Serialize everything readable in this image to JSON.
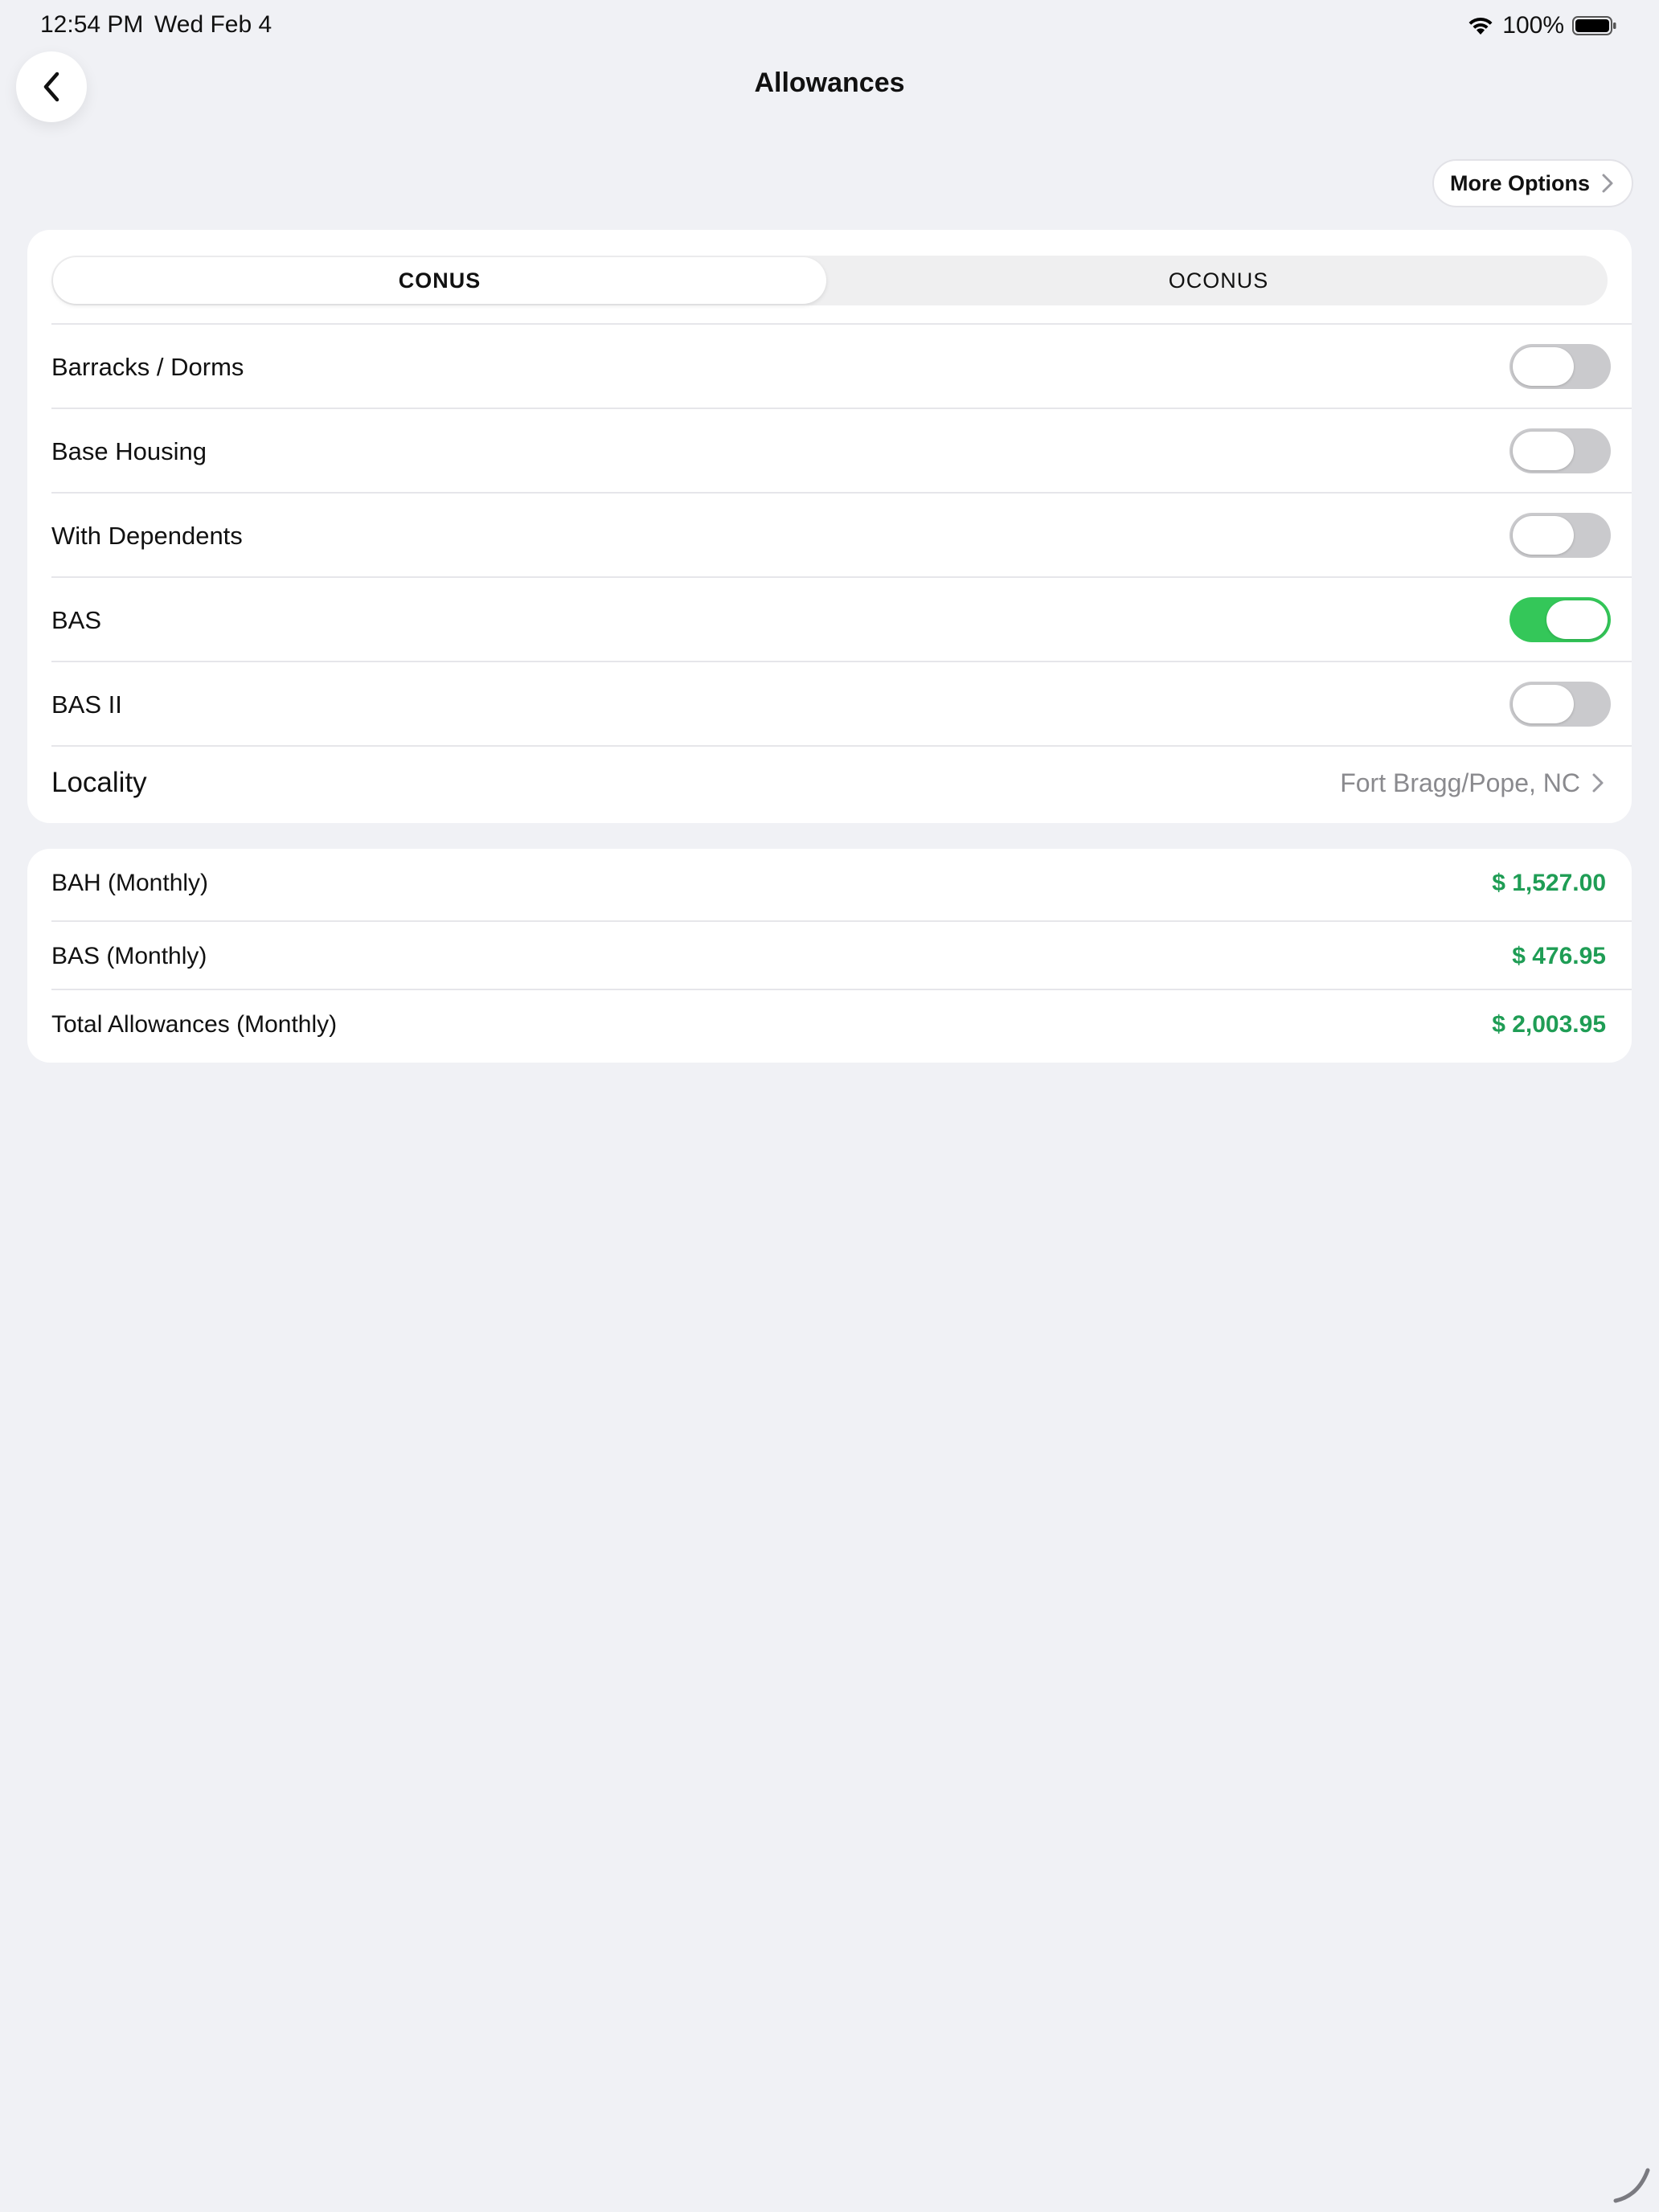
{
  "status_bar": {
    "time": "12:54 PM",
    "date": "Wed Feb 4",
    "battery_percent": "100%",
    "icons": [
      "wifi-icon",
      "battery-icon"
    ]
  },
  "nav": {
    "title": "Allowances",
    "back_icon": "chevron-left-icon"
  },
  "more_options": {
    "label": "More Options"
  },
  "segmented_control": {
    "options": [
      {
        "label": "CONUS",
        "selected": true
      },
      {
        "label": "OCONUS",
        "selected": false
      }
    ]
  },
  "toggles": [
    {
      "label": "Barracks / Dorms",
      "on": false
    },
    {
      "label": "Base Housing",
      "on": false
    },
    {
      "label": "With Dependents",
      "on": false
    },
    {
      "label": "BAS",
      "on": true
    },
    {
      "label": "BAS II",
      "on": false
    }
  ],
  "locality": {
    "label": "Locality",
    "value": "Fort Bragg/Pope, NC"
  },
  "totals": [
    {
      "label": "BAH (Monthly)",
      "value": "$ 1,527.00"
    },
    {
      "label": "BAS (Monthly)",
      "value": "$ 476.95"
    },
    {
      "label": "Total Allowances (Monthly)",
      "value": "$ 2,003.95"
    }
  ],
  "colors": {
    "background": "#F0F1F5",
    "accent_green": "#34C759",
    "value_green": "#1F9D55",
    "toggle_off": "#CACACD"
  }
}
